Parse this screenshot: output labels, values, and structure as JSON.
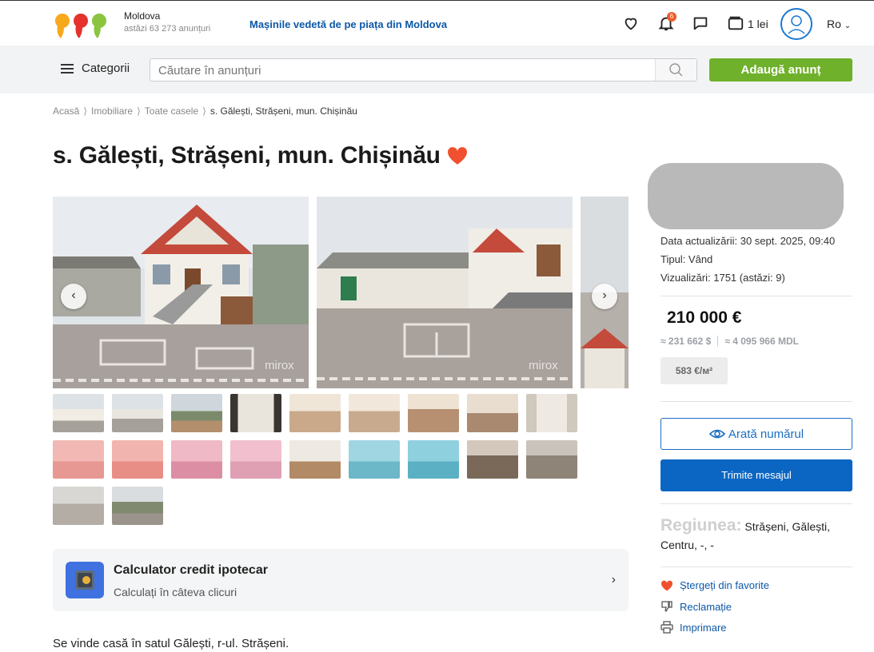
{
  "header": {
    "region_name": "Moldova",
    "region_count": "astăzi 63 273 anunțuri",
    "promo_link": "Mașinile vedetă de pe piața din Moldova",
    "notification_count": "6",
    "wallet": "1 lei",
    "language": "Ro"
  },
  "search": {
    "categories_label": "Categorii",
    "placeholder": "Căutare în anunțuri",
    "add_button": "Adaugă anunț"
  },
  "breadcrumb": [
    "Acasă",
    "Imobiliare",
    "Toate casele",
    "s. Gălești, Strășeni, mun. Chișinău"
  ],
  "listing": {
    "title": "s. Gălești, Strășeni, mun. Chișinău",
    "watermark": "mirox",
    "description": "Se vinde casă în satul Gălești, r-ul. Strășeni."
  },
  "calculator": {
    "title": "Calculator credit ipotecar",
    "subtitle": "Calculați în câteva clicuri",
    "chevron": "›"
  },
  "sidebar": {
    "updated": "Data actualizării: 30 sept. 2025, 09:40",
    "type": "Tipul: Vând",
    "views": "Vizualizări: 1751 (astăzi: 9)",
    "price": "210 000 €",
    "price_usd": "≈ 231 662 $",
    "price_mdl": "≈ 4 095 966 MDL",
    "price_per_m2": "583 €/м²",
    "show_number": "Arată numărul",
    "send_message": "Trimite mesajul",
    "region_label": "Regiunea:",
    "region_value": "Strășeni, Gălești, Centru, -, -",
    "actions": [
      "Ștergeți din favorite",
      "Reclamație",
      "Imprimare"
    ]
  },
  "colors": {
    "brand_blue": "#0b66c3",
    "brand_green": "#6fb12b",
    "accent_red": "#f05a28"
  }
}
